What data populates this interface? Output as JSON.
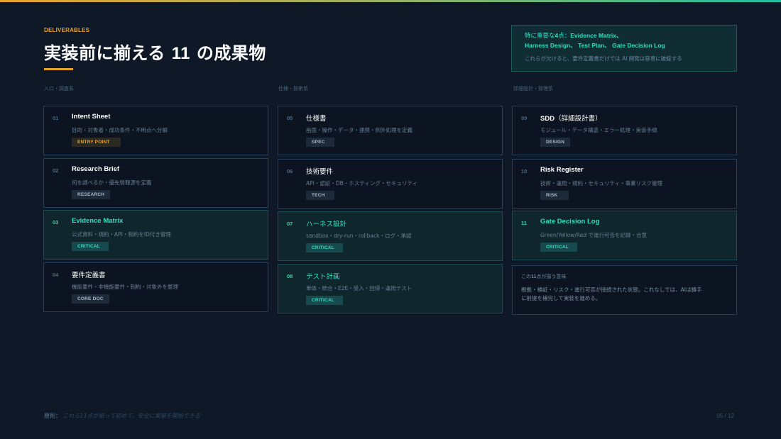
{
  "eyebrow": "DELIVERABLES",
  "title": {
    "pre": "実装前に揃える ",
    "num": "11",
    "post": " の成果物"
  },
  "note": {
    "lead": "特に重要な",
    "count": "4",
    "mid": "点：",
    "item1": "Evidence Matrix、",
    "line2": "Harness Design、 Test Plan、 Gate Decision Log",
    "body": "これらが欠けると、要件定義書だけでは AI 開発は容易に破綻する"
  },
  "columns": [
    "入口・調査系",
    "仕様・技術系",
    "詳細設計・管理系"
  ],
  "cards": [
    {
      "num": "01",
      "name": "Intent Sheet",
      "desc": "目的・対象者・成功条件・不明点へ分解",
      "tag": "ENTRY POINT"
    },
    {
      "num": "02",
      "name": "Research Brief",
      "desc": "何を調べるか・優先情報源を定義",
      "tag": "RESEARCH"
    },
    {
      "num": "03",
      "name": "Evidence Matrix",
      "desc": "公式資料・規約・API・制約をID付き管理",
      "tag": "CRITICAL"
    },
    {
      "num": "04",
      "name": "要件定義書",
      "desc": "機能要件・非機能要件・制約・対象外を整理",
      "tag": "CORE DOC"
    },
    {
      "num": "05",
      "name": "仕様書",
      "desc": "画面・操作・データ・連携・例外処理を定義",
      "tag": "SPEC"
    },
    {
      "num": "06",
      "name": "技術要件",
      "desc": "API・認証・DB・ホスティング・セキュリティ",
      "tag": "TECH"
    },
    {
      "num": "07",
      "name": "ハーネス設計",
      "desc": "sandbox・dry-run・rollback・ログ・承認",
      "tag": "CRITICAL"
    },
    {
      "num": "08",
      "name": "テスト計画",
      "desc": "単体・統合・E2E・受入・回帰・運用テスト",
      "tag": "CRITICAL"
    },
    {
      "num": "09",
      "name": "SDD",
      "name_suffix": "（詳細設計書）",
      "desc": "モジュール・データ構造・エラー処理・実装手順",
      "tag": "DESIGN"
    },
    {
      "num": "10",
      "name": "Risk Register",
      "desc": "技術・運用・規約・セキュリティ・事業リスク管理",
      "tag": "RISK"
    },
    {
      "num": "11",
      "name": "Gate Decision Log",
      "desc": "Green/Yellow/Red で進行可否を記録・合意",
      "tag": "CRITICAL"
    }
  ],
  "summary": {
    "head_pre": "この",
    "head_num": "11",
    "head_post": "点が揃う意味",
    "body_line1": "根拠・検証・リスク・進行可否が接続された状態。これなしでは、AIは勝手",
    "body_line2": "に前提を補完して実装を進める。"
  },
  "footer": {
    "lead": "原則：",
    "principle": "これら11点が揃って初めて、安全に実装を開始できる"
  },
  "page": "05 / 12",
  "colors": {
    "accent_orange": "#e8a32a",
    "accent_teal": "#2ee0c0",
    "background": "#0e1826"
  }
}
